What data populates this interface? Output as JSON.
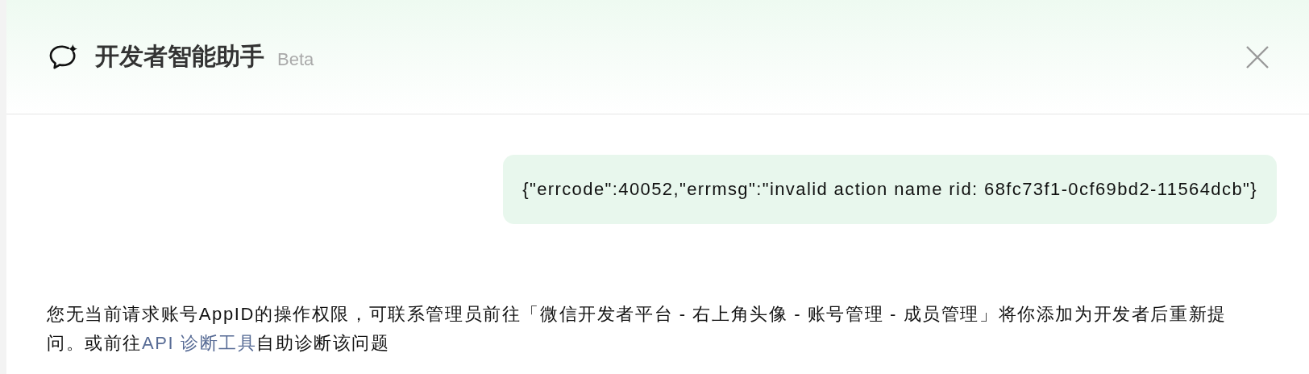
{
  "header": {
    "title": "开发者智能助手",
    "badge": "Beta"
  },
  "messages": [
    {
      "kind": "user",
      "text": "{\"errcode\":40052,\"errmsg\":\"invalid action name rid: 68fc73f1-0cf69bd2-11564dcb\"}"
    },
    {
      "kind": "assistant",
      "before": "您无当前请求账号AppID的操作权限，可联系管理员前往「微信开发者平台 - 右上角头像 - 账号管理 - 成员管理」将你添加为开发者后重新提问。或前往",
      "link": "API 诊断工具",
      "after": "自助诊断该问题"
    }
  ]
}
